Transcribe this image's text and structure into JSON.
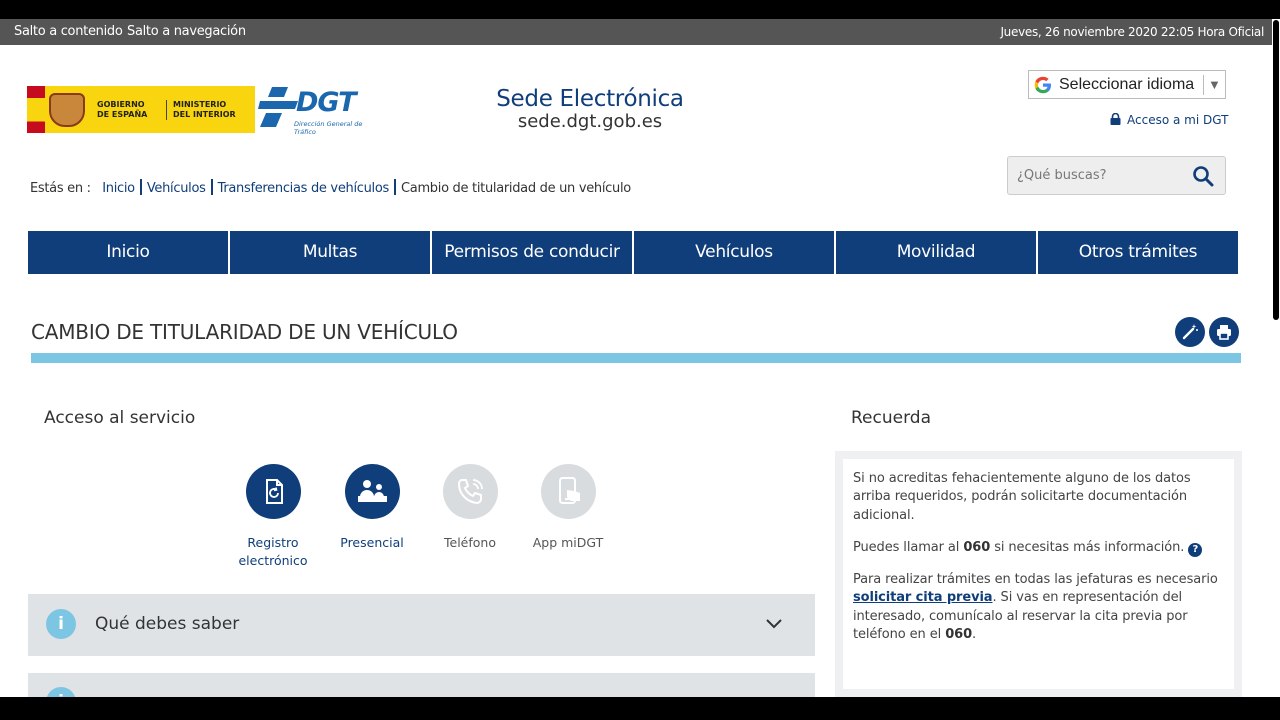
{
  "topbar": {
    "skip_content": "Salto a contenido",
    "skip_nav": "Salto a navegación",
    "datetime": "Jueves, 26 noviembre 2020 22:05 Hora Oficial"
  },
  "header": {
    "gob_line1": "GOBIERNO DE ESPAÑA",
    "gob_line2": "MINISTERIO DEL INTERIOR",
    "dgt_word": "DGT",
    "dgt_sub": "Dirección General de Tráfico",
    "sede_title": "Sede Electrónica",
    "sede_url": "sede.dgt.gob.es",
    "language_select": "Seleccionar idioma",
    "access_link": "Acceso a mi DGT",
    "search_placeholder": "¿Qué buscas?"
  },
  "breadcrumb": {
    "prefix": "Estás en :",
    "items": [
      "Inicio",
      "Vehículos",
      "Transferencias de vehículos"
    ],
    "current": "Cambio de titularidad de un vehículo"
  },
  "nav": [
    "Inicio",
    "Multas",
    "Permisos de conducir",
    "Vehículos",
    "Movilidad",
    "Otros trámites"
  ],
  "page": {
    "title": "CAMBIO DE TITULARIDAD DE UN VEHÍCULO"
  },
  "service": {
    "heading": "Acceso al servicio",
    "options": [
      {
        "label": "Registro electrónico",
        "icon": "document-refresh-icon",
        "active": true
      },
      {
        "label": "Presencial",
        "icon": "in-person-icon",
        "active": true
      },
      {
        "label": "Teléfono",
        "icon": "phone-icon",
        "active": false
      },
      {
        "label": "App miDGT",
        "icon": "mobile-app-icon",
        "active": false
      }
    ]
  },
  "accordion": [
    {
      "label": "Qué debes saber",
      "icon": "info-icon"
    }
  ],
  "recuerda": {
    "heading": "Recuerda",
    "p1": "Si no acreditas fehacientemente alguno de los datos arriba requeridos, podrán solicitarte documentación adicional.",
    "p2_a": "Puedes llamar al ",
    "p2_phone": "060",
    "p2_b": " si necesitas más información.",
    "p3_a": "Para realizar trámites en todas las jefaturas es necesario ",
    "p3_link": "solicitar cita previa",
    "p3_b": ". Si vas en representación del interesado, comunícalo al reservar la cita previa por teléfono en el ",
    "p3_phone": "060",
    "p3_c": "."
  },
  "colors": {
    "primary": "#103e7a",
    "accent": "#7dc6e3",
    "topbar": "#555555"
  }
}
